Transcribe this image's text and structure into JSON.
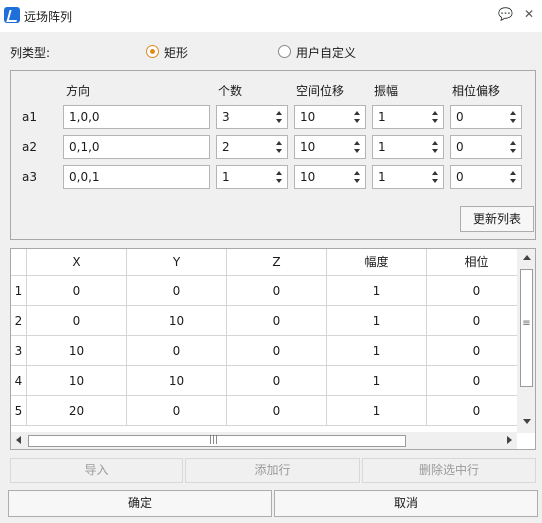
{
  "window": {
    "title": "远场阵列",
    "help_glyph": "💬",
    "close_glyph": "✕"
  },
  "array_type": {
    "label": "列类型:",
    "options": [
      {
        "label": "矩形",
        "checked": true
      },
      {
        "label": "用户自定义",
        "checked": false
      }
    ]
  },
  "params": {
    "headers": {
      "direction": "方向",
      "count": "个数",
      "spacing": "空间位移",
      "amplitude": "振幅",
      "phase": "相位偏移"
    },
    "rows": [
      {
        "label": "a1",
        "direction": "1,0,0",
        "count": "3",
        "spacing": "10",
        "amplitude": "1",
        "phase": "0"
      },
      {
        "label": "a2",
        "direction": "0,1,0",
        "count": "2",
        "spacing": "10",
        "amplitude": "1",
        "phase": "0"
      },
      {
        "label": "a3",
        "direction": "0,0,1",
        "count": "1",
        "spacing": "10",
        "amplitude": "1",
        "phase": "0"
      }
    ],
    "update_button": "更新列表"
  },
  "table": {
    "columns": [
      "X",
      "Y",
      "Z",
      "幅度",
      "相位"
    ],
    "rows": [
      {
        "num": "1",
        "cells": [
          "0",
          "0",
          "0",
          "1",
          "0"
        ]
      },
      {
        "num": "2",
        "cells": [
          "0",
          "10",
          "0",
          "1",
          "0"
        ]
      },
      {
        "num": "3",
        "cells": [
          "10",
          "0",
          "0",
          "1",
          "0"
        ]
      },
      {
        "num": "4",
        "cells": [
          "10",
          "10",
          "0",
          "1",
          "0"
        ]
      },
      {
        "num": "5",
        "cells": [
          "20",
          "0",
          "0",
          "1",
          "0"
        ]
      }
    ],
    "scroll_grip": "≡",
    "hscroll_grip": "|||"
  },
  "actions": {
    "import": "导入",
    "add_row": "添加行",
    "delete_row": "删除选中行"
  },
  "footer": {
    "ok": "确定",
    "cancel": "取消"
  },
  "colors": {
    "accent": "#e08a1e",
    "app_icon": "#1e6fd9"
  }
}
